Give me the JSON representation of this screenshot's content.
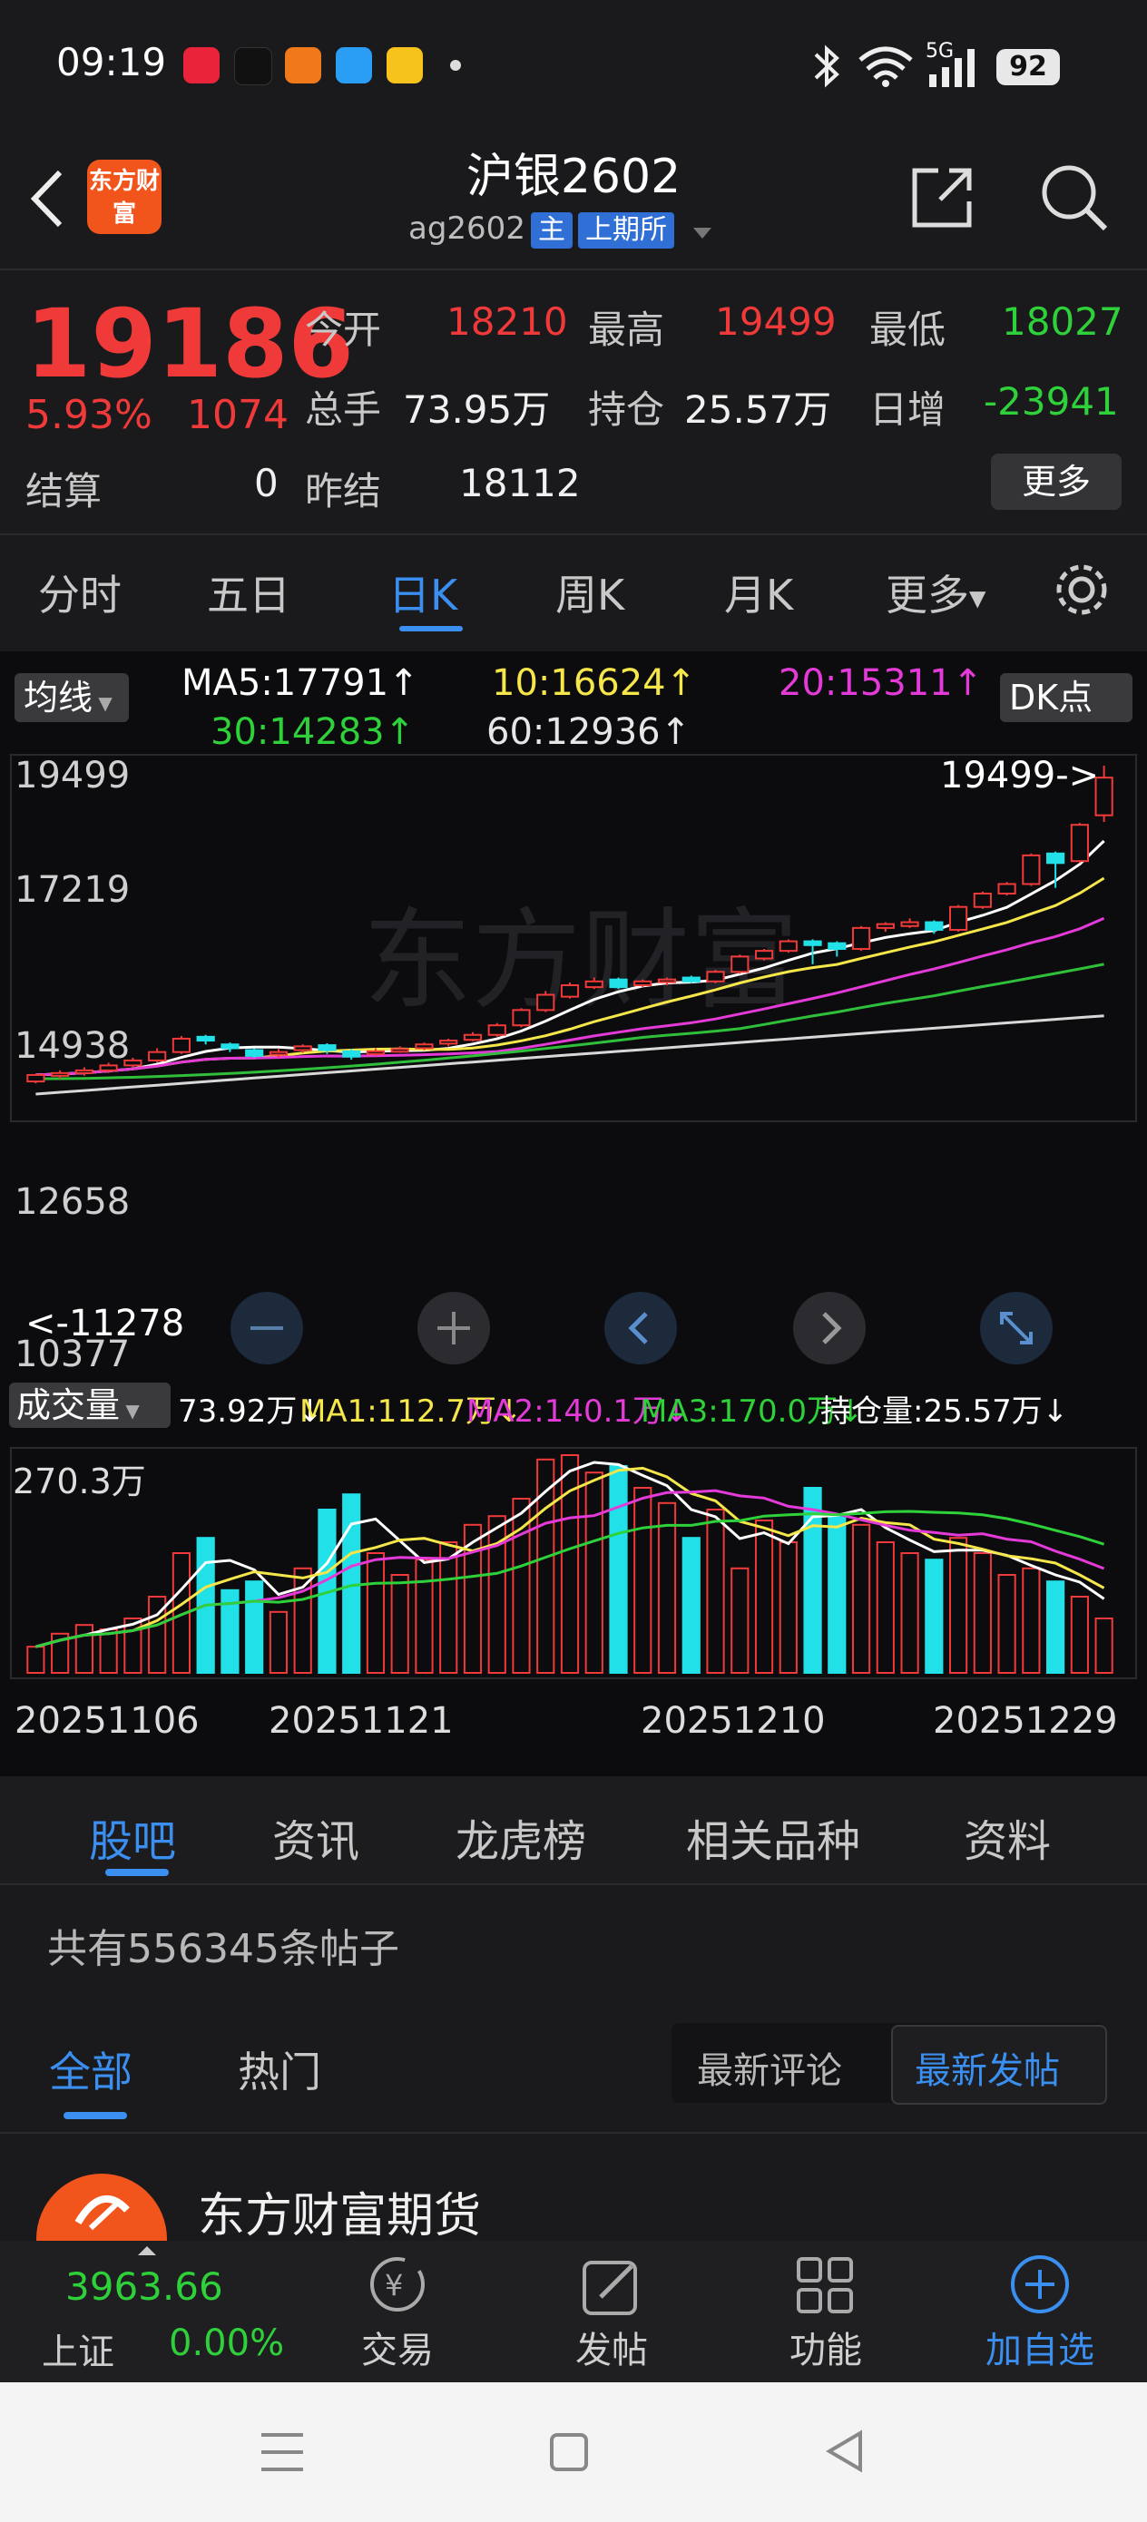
{
  "status_bar": {
    "time": "09:19",
    "network": "5G",
    "battery": "92"
  },
  "header": {
    "title": "沪银2602",
    "code": "ag2602",
    "tag_main": "主",
    "tag_exchange": "上期所",
    "logo_text": "东方财富"
  },
  "quote": {
    "price": "19186",
    "change_pct": "5.93%",
    "change": "1074",
    "open_label": "今开",
    "open": "18210",
    "high_label": "最高",
    "high": "19499",
    "low_label": "最低",
    "low": "18027",
    "volume_label": "总手",
    "volume": "73.95万",
    "oi_label": "持仓",
    "oi": "25.57万",
    "daily_inc_label": "日增",
    "daily_inc": "-23941",
    "settle_label": "结算",
    "settle": "0",
    "prev_settle_label": "昨结",
    "prev_settle": "18112",
    "more_button": "更多"
  },
  "kline_tabs": [
    "分时",
    "五日",
    "日K",
    "周K",
    "月K",
    "更多"
  ],
  "ma_legend": {
    "selector": "均线",
    "ma5": "MA5:17791↑",
    "ma10": "10:16624↑",
    "ma20": "20:15311↑",
    "ma30": "30:14283↑",
    "ma60": "60:12936↑",
    "dk_button": "DK点"
  },
  "price_axis": [
    "19499",
    "17219",
    "14938",
    "12658",
    "10377"
  ],
  "high_marker": "19499->",
  "low_marker": "<-11278",
  "volume_legend": {
    "selector": "成交量",
    "vol": "73.92万↓",
    "ma1": "MA1:112.7万↓",
    "ma2": "MA2:140.1万↓",
    "ma3": "MA3:170.0万↓",
    "oi": "持仓量:25.57万↓"
  },
  "volume_axis_max": "270.3万",
  "date_axis": [
    "20251106",
    "20251121",
    "20251210",
    "20251229"
  ],
  "watermark": "东方财富",
  "colors": {
    "up": "#f03a3a",
    "down": "#22e0e8",
    "ma5": "#ffffff",
    "ma10": "#f5e64a",
    "ma20": "#e33ad8",
    "ma30": "#2fbf3a",
    "ma60": "#d8d8d8",
    "accent": "#3a8ff0"
  },
  "chart_data": {
    "type": "candlestick",
    "ylim": [
      10377,
      19499
    ],
    "dates_shown": [
      "20251106",
      "20251121",
      "20251210",
      "20251229"
    ],
    "candles": [
      [
        11230,
        11400,
        11180,
        11420
      ],
      [
        11400,
        11450,
        11300,
        11520
      ],
      [
        11450,
        11520,
        11380,
        11600
      ],
      [
        11520,
        11650,
        11450,
        11720
      ],
      [
        11650,
        11780,
        11600,
        11850
      ],
      [
        11780,
        12000,
        11720,
        12100
      ],
      [
        12000,
        12350,
        11950,
        12420
      ],
      [
        12400,
        12300,
        12200,
        12450
      ],
      [
        12200,
        12100,
        12000,
        12250
      ],
      [
        12050,
        11900,
        11850,
        12100
      ],
      [
        11950,
        12000,
        11850,
        12080
      ],
      [
        12050,
        12150,
        11980,
        12200
      ],
      [
        12180,
        12050,
        11950,
        12230
      ],
      [
        12020,
        11880,
        11800,
        12080
      ],
      [
        11950,
        12020,
        11900,
        12100
      ],
      [
        12050,
        12080,
        11980,
        12150
      ],
      [
        12100,
        12200,
        12050,
        12250
      ],
      [
        12220,
        12300,
        12150,
        12350
      ],
      [
        12320,
        12450,
        12280,
        12520
      ],
      [
        12450,
        12700,
        12400,
        12760
      ],
      [
        12700,
        13100,
        12650,
        13150
      ],
      [
        13100,
        13500,
        13050,
        13600
      ],
      [
        13450,
        13750,
        13400,
        13820
      ],
      [
        13700,
        13850,
        13650,
        13950
      ],
      [
        13900,
        13700,
        13650,
        13950
      ],
      [
        13750,
        13850,
        13700,
        13900
      ],
      [
        13850,
        13900,
        13750,
        13950
      ],
      [
        13950,
        13850,
        13800,
        14000
      ],
      [
        13850,
        14100,
        13800,
        14150
      ],
      [
        14100,
        14500,
        14050,
        14550
      ],
      [
        14450,
        14650,
        14400,
        14700
      ],
      [
        14650,
        14900,
        14600,
        14950
      ],
      [
        14900,
        14800,
        14300,
        14950
      ],
      [
        14850,
        14700,
        14500,
        14900
      ],
      [
        14700,
        15250,
        14650,
        15300
      ],
      [
        15250,
        15350,
        15150,
        15400
      ],
      [
        15300,
        15400,
        15250,
        15500
      ],
      [
        15400,
        15200,
        15100,
        15450
      ],
      [
        15200,
        15800,
        15150,
        15850
      ],
      [
        15800,
        16150,
        15750,
        16200
      ],
      [
        16150,
        16400,
        16100,
        16450
      ],
      [
        16400,
        17150,
        16350,
        17200
      ],
      [
        17200,
        16950,
        16300,
        17250
      ],
      [
        17000,
        17950,
        16950,
        18000
      ],
      [
        18200,
        19186,
        18027,
        19499
      ]
    ],
    "volume_max": "270.3万"
  }
}
